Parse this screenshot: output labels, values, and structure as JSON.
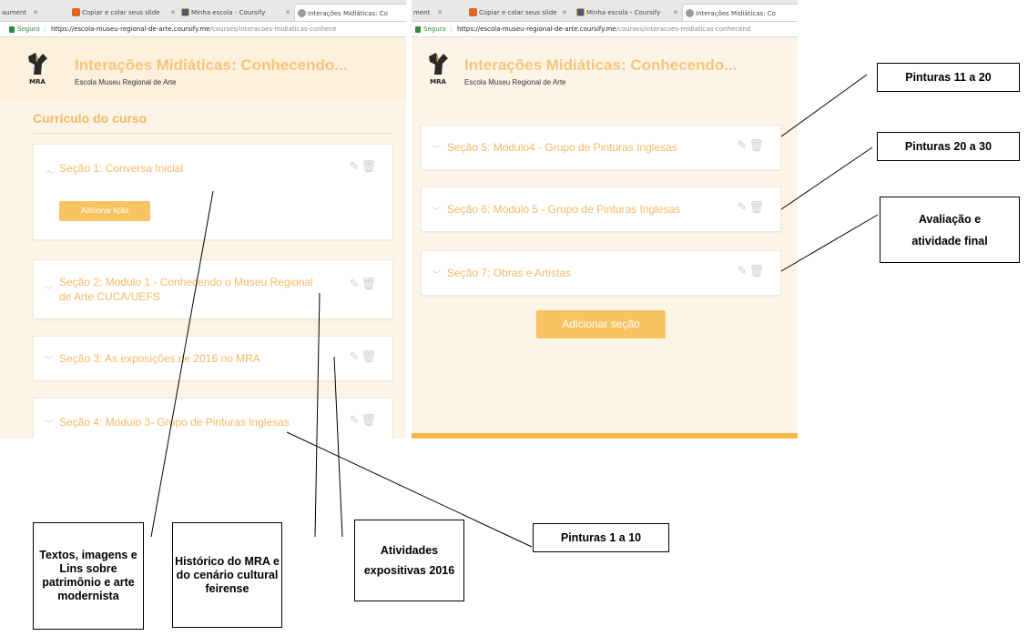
{
  "left_screenshot": {
    "tabs": {
      "cut": "aument",
      "tab2": "Copiar e colar seus slide",
      "tab3": "Minha escola - Coursify",
      "tab4": "Interações Midiáticas: Co"
    },
    "url": {
      "secure_label": "Seguro",
      "host": "https://escola-museu-regional-de-arte.coursify.me",
      "path": "/courses/interacoes-midiaticas-conhece"
    },
    "course_title": "Interações Midiáticas: Conhecendo...",
    "school_name": "Escola Museu Regional de Arte",
    "logo_text": "MRA",
    "curriculum_title": "Currículo do curso",
    "add_lesson_label": "Adicionar lição",
    "sections": [
      {
        "title": "Seção 1: Conversa Inicial"
      },
      {
        "title": "Seção 2: Módulo 1 - Conhecendo o Museu Regional de Arte CUCA/UEFS"
      },
      {
        "title": "Seção 3: As exposições de 2016 no MRA"
      },
      {
        "title": "Seção 4: Módulo 3- Grupo de Pinturas Inglesas"
      }
    ]
  },
  "right_screenshot": {
    "tabs": {
      "cut": "ment",
      "tab2": "Copiar e colar seus slide",
      "tab3": "Minha escola - Coursify",
      "tab4": "Interações Midiáticas: Co"
    },
    "url": {
      "secure_label": "Seguro",
      "host": "https://escola-museu-regional-de-arte.coursify.me",
      "path": "/courses/interacoes-midiaticas-conhecend"
    },
    "course_title": "Interações Midiáticas: Conhecendo...",
    "school_name": "Escola Museu Regional de Arte",
    "logo_text": "MRA",
    "add_section_label": "Adicionar seção",
    "sections": [
      {
        "title": "Seção 5: Módulo4 - Grupo de Pinturas Inglesas"
      },
      {
        "title": "Seção 6: Módulo 5 - Grupo de Pinturas Inglesas"
      },
      {
        "title": "Seção 7: Obras e Artistas"
      }
    ]
  },
  "callouts": {
    "textos": "Textos, imagens e Lins sobre patrimônio e arte modernista",
    "historico": "Histórico do MRA e do cenário cultural feirense",
    "atividades": "Atividades expositivas 2016",
    "pinturas_1_10": "Pinturas 1 a 10",
    "pinturas_11_20": "Pinturas 11 a 20",
    "pinturas_20_30": "Pinturas 20 a 30",
    "avaliacao": "Avaliação e atividade final"
  },
  "icons": {
    "edit": "edit-icon",
    "delete": "trash-icon",
    "chevron_up": "chevron-up-icon",
    "chevron_down": "chevron-down-icon",
    "lock": "lock-icon"
  },
  "colors": {
    "accent": "#f4b963",
    "button": "#f8c463",
    "page_bg": "#fdf4e8"
  }
}
